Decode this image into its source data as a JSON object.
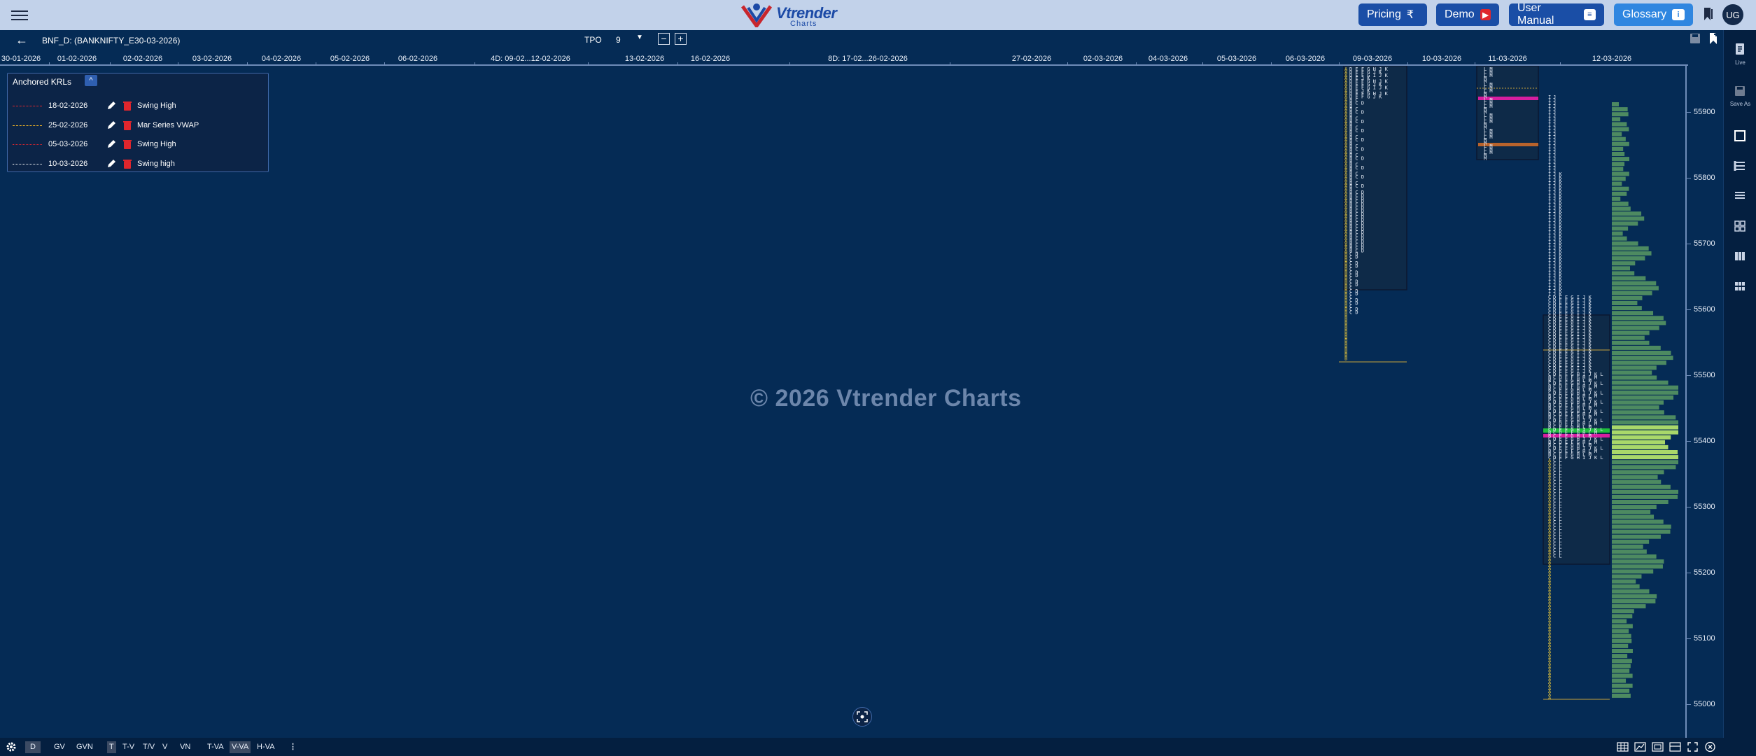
{
  "header": {
    "logo_text": "Vtrender",
    "logo_sub": "Charts",
    "buttons": [
      {
        "label": "Pricing",
        "icon": "rupee-icon",
        "symbol": "₹"
      },
      {
        "label": "Demo",
        "icon": "youtube-icon",
        "symbol": "▶"
      },
      {
        "label": "User Manual",
        "icon": "document-icon",
        "symbol": "≡"
      },
      {
        "label": "Glossary",
        "icon": "info-icon",
        "symbol": "i"
      }
    ],
    "avatar": "UG"
  },
  "toolbar": {
    "symbol": "BNF_D: (BANKNIFTY_E30-03-2026)",
    "tpo_label": "TPO",
    "tpo_value": "9",
    "minus": "−",
    "plus": "+"
  },
  "date_axis": [
    "30-01-2026",
    "01-02-2026",
    "02-02-2026",
    "03-02-2026",
    "04-02-2026",
    "05-02-2026",
    "06-02-2026",
    "4D: 09-02...12-02-2026",
    "13-02-2026",
    "16-02-2026",
    "8D: 17-02...26-02-2026",
    "27-02-2026",
    "02-03-2026",
    "04-03-2026",
    "05-03-2026",
    "06-03-2026",
    "09-03-2026",
    "10-03-2026",
    "11-03-2026",
    "12-03-2026"
  ],
  "krl": {
    "title": "Anchored KRLs",
    "toggle": "^",
    "rows": [
      {
        "date": "18-02-2026",
        "name": "Swing High",
        "color": "#e0262d",
        "style": "dashed"
      },
      {
        "date": "25-02-2026",
        "name": "Mar Series VWAP",
        "color": "#f0b323",
        "style": "dashed"
      },
      {
        "date": "05-03-2026",
        "name": "Swing High",
        "color": "#e0262d",
        "style": "dotted"
      },
      {
        "date": "10-03-2026",
        "name": "Swing high",
        "color": "#ffffff",
        "style": "dotted"
      }
    ]
  },
  "price_axis": [
    "55900",
    "55800",
    "55700",
    "55600",
    "55500",
    "55400",
    "55300",
    "55200",
    "55100",
    "55000"
  ],
  "watermark": "© 2026 Vtrender Charts",
  "profiles": {
    "p1_sample": [
      "ADEFGHJK",
      "ADEFGJK",
      "ADEFGIJK",
      "ADEJK",
      "BCD",
      "BCD",
      "BC",
      "B"
    ],
    "p2_sample": [
      "LM",
      "LM",
      "LM",
      "M",
      "M"
    ],
    "p3_sample": [
      "CDEFGHIJKL",
      "BCDEFGHLM",
      "BCEFGHLM",
      "ACL",
      "AB"
    ]
  },
  "sidepanel": {
    "live_label": "Live",
    "saveas_label": "Save As"
  },
  "bottom": {
    "left": [
      "D",
      "GV",
      "GVN",
      "T",
      "T-V",
      "T/V",
      "V",
      "VN",
      "T-VA",
      "V-VA",
      "H-VA",
      "⋮"
    ],
    "active": [
      "D",
      "T",
      "V-VA"
    ]
  },
  "colors": {
    "background": "#052b55",
    "header": "#c2d2ea",
    "accent": "#1a4ea6",
    "poc_highlight": "#1fbf3c",
    "vwap_highlight": "#d61ea0"
  }
}
